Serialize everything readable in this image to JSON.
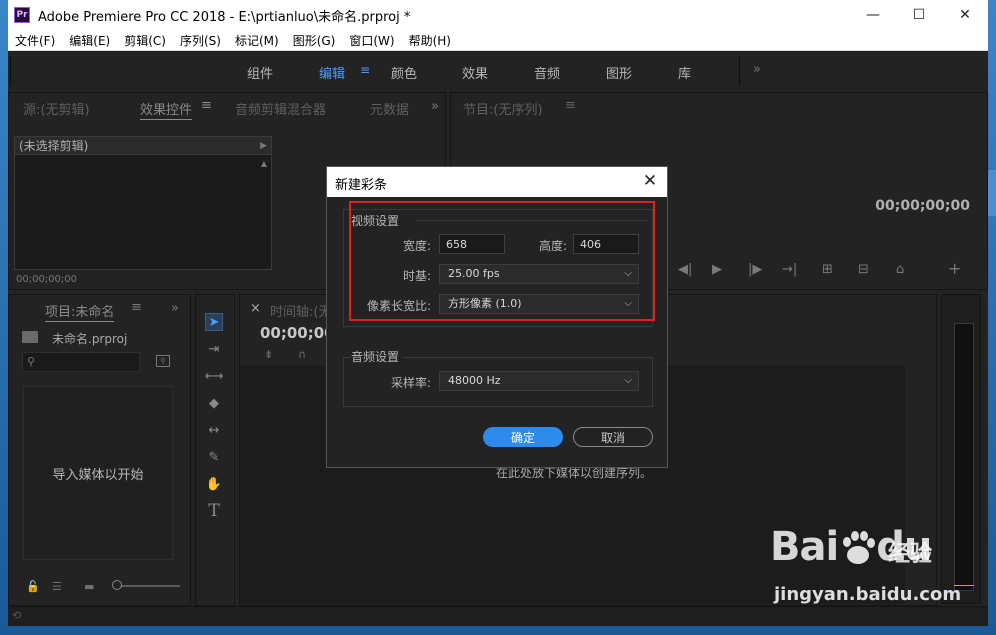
{
  "window": {
    "title": "Adobe Premiere Pro CC 2018 - E:\\prtianluo\\未命名.prproj *",
    "app_icon": "Pr",
    "minimize": "—",
    "maximize": "☐",
    "close": "✕"
  },
  "menu": [
    "文件(F)",
    "编辑(E)",
    "剪辑(C)",
    "序列(S)",
    "标记(M)",
    "图形(G)",
    "窗口(W)",
    "帮助(H)"
  ],
  "workspaces": {
    "tabs": [
      "组件",
      "编辑",
      "颜色",
      "效果",
      "音频",
      "图形",
      "库"
    ],
    "active": "编辑",
    "menu_glyph": "≡",
    "more": "»"
  },
  "source_panel": {
    "tabs": [
      "源:(无剪辑)",
      "效果控件",
      "音频剪辑混合器",
      "元数据"
    ],
    "active_menu": "≡",
    "more": "»",
    "no_clip": "(未选择剪辑)",
    "timecode": "00;00;00;00"
  },
  "program_panel": {
    "tab": "节目:(无序列)",
    "menu": "≡",
    "timecode": "00;00;00;00"
  },
  "project_panel": {
    "tab": "项目:未命名",
    "menu": "≡",
    "more": "»",
    "file": "未命名.prproj",
    "drop_hint": "导入媒体以开始"
  },
  "timeline_panel": {
    "close": "×",
    "tab": "时间轴:(无序列)",
    "timecode": "00;00;00",
    "drop_hint": "在此处放下媒体以创建序列。"
  },
  "dialog": {
    "title": "新建彩条",
    "close": "✕",
    "video_group": "视频设置",
    "width_label": "宽度:",
    "width_value": "658",
    "height_label": "高度:",
    "height_value": "406",
    "timebase_label": "时基:",
    "timebase_value": "25.00 fps",
    "par_label": "像素长宽比:",
    "par_value": "方形像素 (1.0)",
    "audio_group": "音频设置",
    "samplerate_label": "采样率:",
    "samplerate_value": "48000 Hz",
    "ok": "确定",
    "cancel": "取消"
  },
  "watermark": {
    "logo": "Bai",
    "logo2": "du",
    "cn": "经验",
    "url": "jingyan.baidu.com"
  },
  "colors": {
    "accent": "#4a9eff",
    "ok_button": "#2d8ceb",
    "highlight_box": "#e02020"
  }
}
